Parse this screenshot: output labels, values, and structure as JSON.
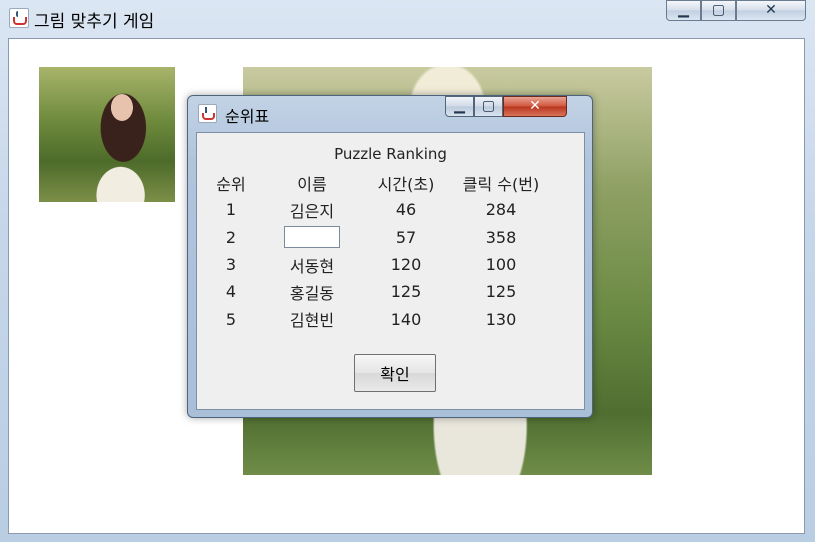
{
  "window": {
    "title": "그림 맞추기 게임",
    "buttons": {
      "minimize": "▁",
      "maximize": "▢",
      "close": "✕"
    }
  },
  "dialog": {
    "title": "순위표",
    "heading": "Puzzle Ranking",
    "columns": [
      "순위",
      "이름",
      "시간(초)",
      "클릭 수(번)"
    ],
    "rows": [
      {
        "rank": "1",
        "name": "김은지",
        "time": "46",
        "clicks": "284"
      },
      {
        "rank": "2",
        "name": "",
        "time": "57",
        "clicks": "358"
      },
      {
        "rank": "3",
        "name": "서동현",
        "time": "120",
        "clicks": "100"
      },
      {
        "rank": "4",
        "name": "홍길동",
        "time": "125",
        "clicks": "125"
      },
      {
        "rank": "5",
        "name": "김현빈",
        "time": "140",
        "clicks": "130"
      }
    ],
    "ok_label": "확인",
    "buttons": {
      "minimize": "▁",
      "maximize": "▢",
      "close": "✕"
    }
  },
  "icons": [
    "java-cup-icon",
    "minimize-icon",
    "maximize-icon",
    "close-icon"
  ]
}
